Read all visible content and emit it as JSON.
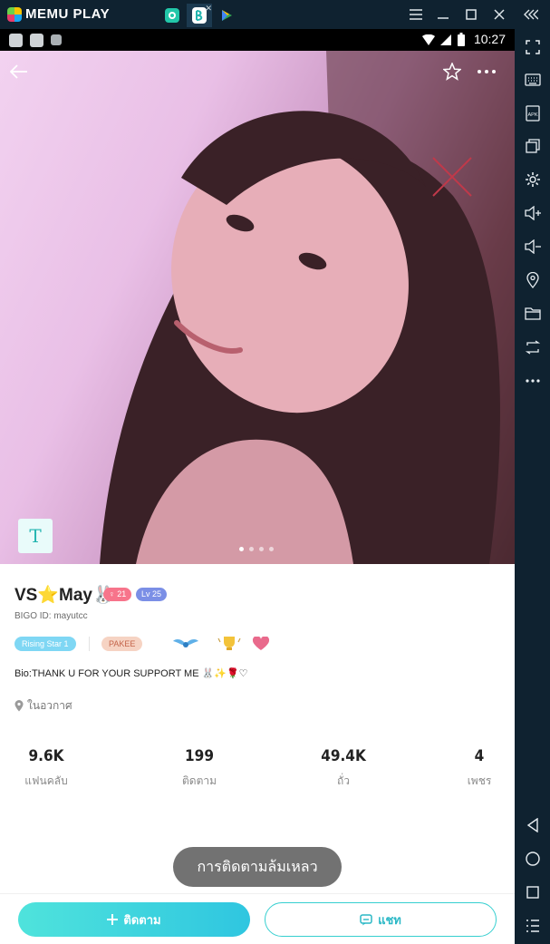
{
  "emulator": {
    "brand": "MEMU PLAY",
    "colors": {
      "bar": "#0f2230",
      "accent": "#2fc6e0"
    },
    "window_buttons": [
      "menu-icon",
      "minimize-icon",
      "maximize-icon",
      "close-icon",
      "collapse-icon"
    ],
    "tabs": [
      "app-icon-green",
      "app-icon-bigo",
      "play-store-icon"
    ],
    "sidebar_tools": [
      "fullscreen-icon",
      "keyboard-icon",
      "apk-icon",
      "multi-window-icon",
      "settings-icon",
      "volume-up-icon",
      "volume-down-icon",
      "location-icon",
      "folder-icon",
      "sync-icon",
      "more-icon",
      "back-icon",
      "home-icon",
      "recents-icon",
      "list-icon"
    ]
  },
  "statusbar": {
    "time": "10:27"
  },
  "profile": {
    "name": "VS⭐May🐰",
    "gender_age_badge": "21",
    "level_badge": "Lv 25",
    "bigo_id": "BIGO ID: mayutcc",
    "badges": [
      "Rising Star 1",
      "PAKEE"
    ],
    "bio": "Bio:THANK U FOR YOUR SUPPORT ME 🐰✨🌹♡",
    "location": "ในอวกาศ"
  },
  "stats": [
    {
      "value": "9.6K",
      "label": "แฟนคลับ"
    },
    {
      "value": "199",
      "label": "ติดตาม"
    },
    {
      "value": "49.4K",
      "label": "ถั่ว"
    },
    {
      "value": "4",
      "label": "เพชร"
    }
  ],
  "toast": "การติดตามล้มเหลว",
  "actions": {
    "follow": "ติดตาม",
    "chat": "แชท"
  },
  "photo": {
    "badge_letter": "T",
    "page_count": 4,
    "current_page": 1
  }
}
